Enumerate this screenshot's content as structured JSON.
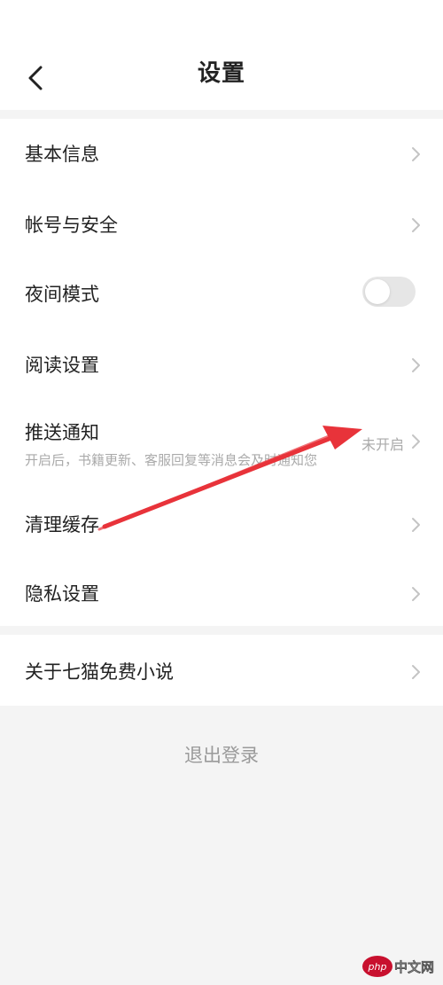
{
  "header": {
    "title": "设置",
    "back_icon": "chevron-left-icon"
  },
  "settings": {
    "basic_info": "基本信息",
    "account_security": "帐号与安全",
    "night_mode": "夜间模式",
    "night_mode_on": false,
    "reading_settings": "阅读设置",
    "push_notification": "推送通知",
    "push_notification_desc": "开启后，书籍更新、客服回复等消息会及时通知您",
    "push_notification_status": "未开启",
    "clear_cache": "清理缓存",
    "privacy_settings": "隐私设置"
  },
  "about": {
    "label": "关于七猫免费小说"
  },
  "logout": {
    "label": "退出登录"
  },
  "annotation": {
    "color": "#e8333a"
  },
  "watermark": {
    "brand": "php",
    "text": "中文网",
    "color": "#c8102e"
  }
}
